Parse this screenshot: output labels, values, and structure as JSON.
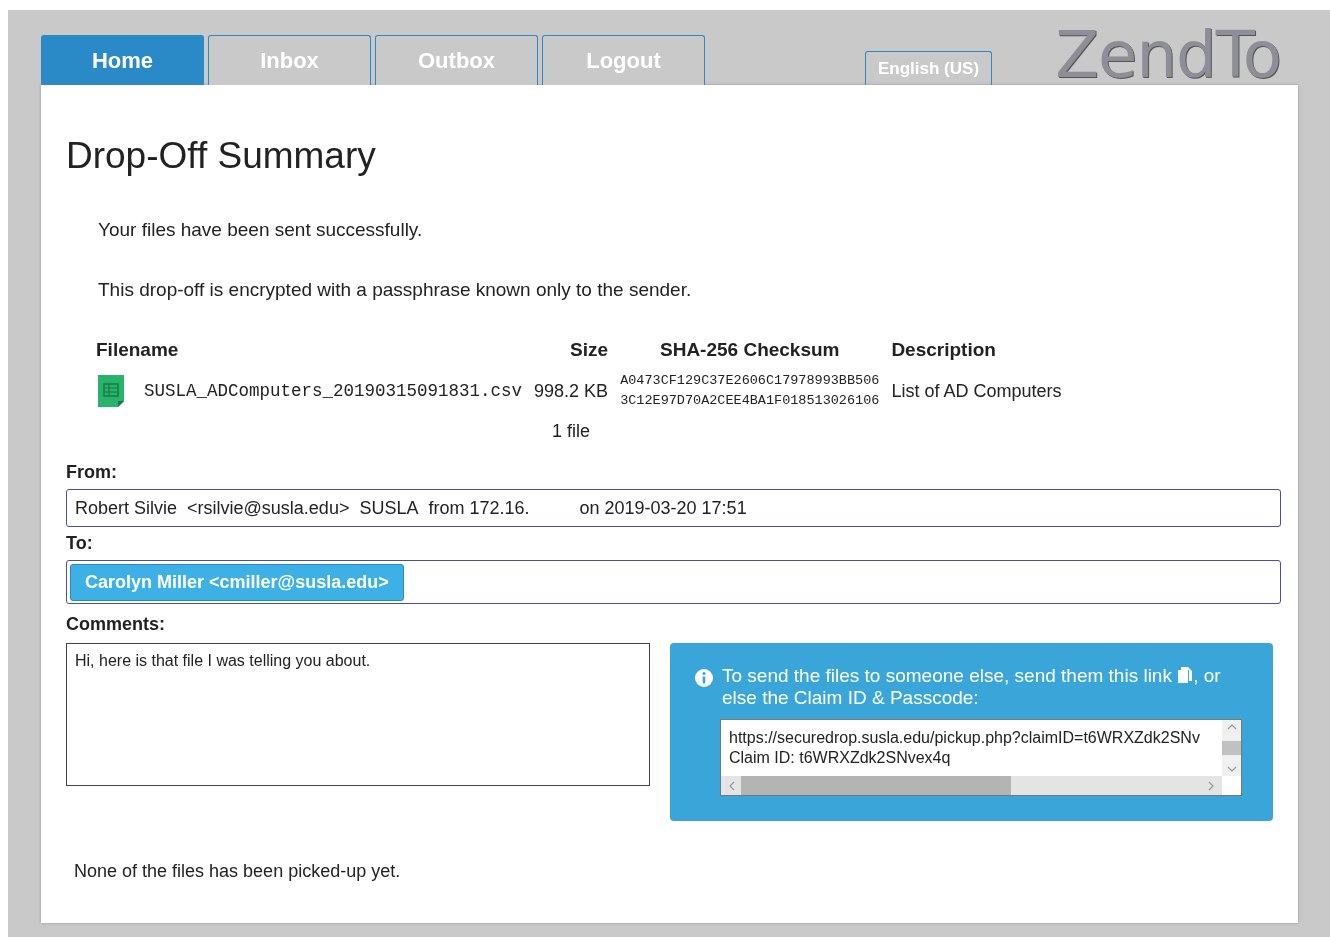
{
  "tabs": [
    {
      "label": "Home",
      "selected": true
    },
    {
      "label": "Inbox",
      "selected": false
    },
    {
      "label": "Outbox",
      "selected": false
    },
    {
      "label": "Logout",
      "selected": false
    }
  ],
  "language": "English (US)",
  "logo": "ZendTo",
  "title": "Drop-Off Summary",
  "messages": [
    "Your files have been sent successfully.",
    "This drop-off is encrypted with a passphrase known only to the sender."
  ],
  "files": {
    "columns": [
      "Filename",
      "Size",
      "SHA-256 Checksum",
      "Description"
    ],
    "rows": [
      {
        "name": "SUSLA_ADComputers_20190315091831.csv",
        "size": "998.2 KB",
        "checksum": [
          "A0473CF129C37E2606C17978993BB506",
          "3C12E97D70A2CEE4BA1F018513026106"
        ],
        "description": "List of AD Computers"
      }
    ],
    "total": "1 file"
  },
  "from": {
    "label": "From:",
    "name": "Robert Silvie",
    "email": "<rsilvie@susla.edu>",
    "org": "SUSLA",
    "address": "from 172.16.",
    "date": "on 2019-03-20 17:51"
  },
  "to": {
    "label": "To:",
    "recipients": [
      "Carolyn Miller <cmiller@susla.edu>"
    ]
  },
  "comments": {
    "label": "Comments:",
    "value": "Hi, here is that file I was telling you about."
  },
  "share": {
    "text_before": "To send the files to someone else, send them this link",
    "text_after": ", or else the Claim ID & Passcode:",
    "lines": [
      "https://securedrop.susla.edu/pickup.php?claimID=t6WRXZdk2SNv",
      "Claim ID: t6WRXZdk2SNvex4q"
    ]
  },
  "status": "None of the files has been picked-up yet."
}
